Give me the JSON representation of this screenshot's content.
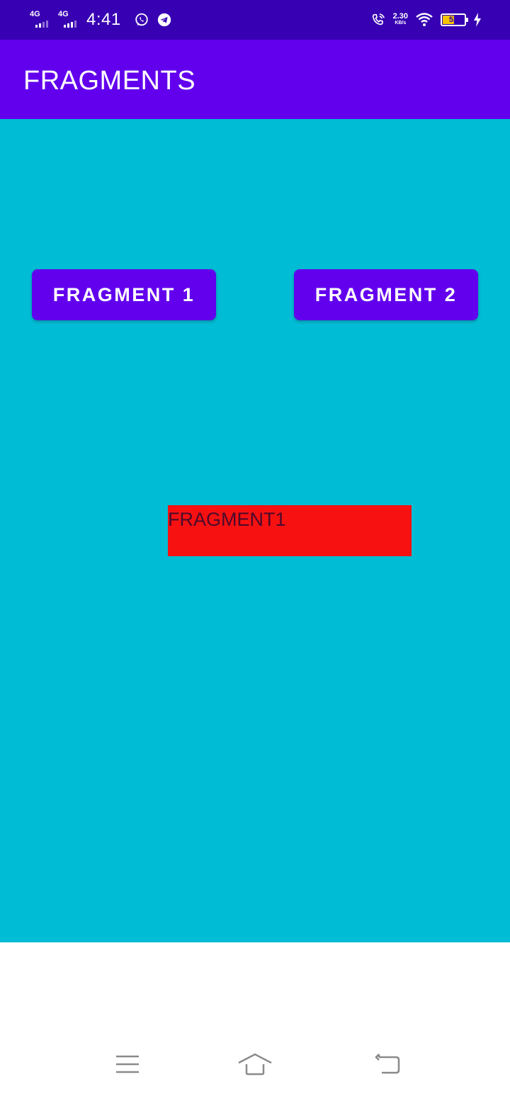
{
  "status_bar": {
    "network_1": "4G",
    "network_2": "4G",
    "time": "4:41",
    "speed_value": "2.30",
    "speed_unit": "KB/s",
    "battery_percent": "52",
    "battery_level": 0.52,
    "icons": [
      "whatsapp-icon",
      "telegram-icon",
      "wifi-call-icon",
      "wifi-icon",
      "battery-icon",
      "charging-icon"
    ]
  },
  "app_bar": {
    "title": "FRAGMENTS"
  },
  "main": {
    "button_1_label": "FRAGMENT 1",
    "button_2_label": "FRAGMENT 2",
    "fragment_text": "FRAGMENT1"
  },
  "nav_bar": {
    "icons": [
      "menu-icon",
      "home-icon",
      "back-icon"
    ]
  },
  "colors": {
    "status_bar": "#3700b3",
    "app_bar": "#6200ee",
    "content_background": "#00bcd4",
    "fragment_background": "#f71111",
    "button": "#6200ee"
  }
}
